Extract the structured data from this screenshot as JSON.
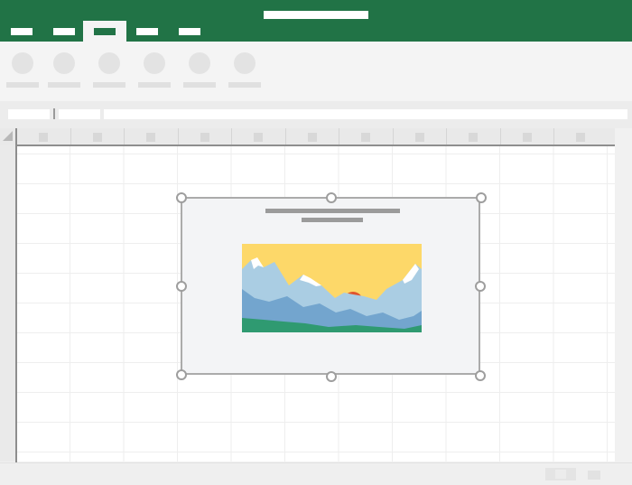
{
  "window": {
    "title_bar_color": "#217346",
    "title_text": "",
    "tabs": [
      {
        "label": "",
        "active": false
      },
      {
        "label": "",
        "active": false
      },
      {
        "label": "",
        "active": true
      },
      {
        "label": "",
        "active": false
      },
      {
        "label": "",
        "active": false
      }
    ]
  },
  "ribbon": {
    "buttons": [
      {
        "icon": "placeholder-circle-icon",
        "label": ""
      },
      {
        "icon": "placeholder-circle-icon",
        "label": ""
      },
      {
        "icon": "placeholder-circle-icon",
        "label": ""
      },
      {
        "icon": "placeholder-circle-icon",
        "label": ""
      },
      {
        "icon": "placeholder-circle-icon",
        "label": ""
      },
      {
        "icon": "placeholder-circle-icon",
        "label": ""
      }
    ]
  },
  "formula_bar": {
    "name_box": "",
    "function_box": "",
    "formula": ""
  },
  "sheet": {
    "column_count": 11,
    "select_all_icon": "select-all-triangle-icon"
  },
  "chart_object": {
    "title": "",
    "subtitle": "",
    "image_icon": "landscape-picture-icon",
    "selected": true,
    "colors": {
      "sky": "#fdd869",
      "sun": "#e0542d",
      "far_mountains": "#aacde3",
      "snow": "#ffffff",
      "near_mountains": "#73a5ce",
      "ground": "#2f9a71"
    }
  },
  "status_bar": {
    "view_buttons": [
      "normal-view-icon",
      "page-layout-icon"
    ]
  }
}
